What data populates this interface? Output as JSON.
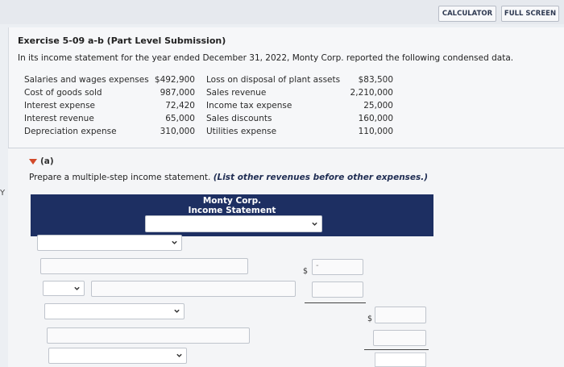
{
  "toolbar": {
    "calculator_label": "CALCULATOR",
    "fullscreen_label": "FULL SCREEN"
  },
  "exercise": {
    "title": "Exercise 5-09 a-b (Part Level Submission)",
    "intro": "In its income statement for the year ended December 31, 2022, Monty Corp. reported the following condensed data."
  },
  "data_table": {
    "left": [
      {
        "label": "Salaries and wages expenses",
        "value": "$492,900"
      },
      {
        "label": "Cost of goods sold",
        "value": "987,000"
      },
      {
        "label": "Interest expense",
        "value": "72,420"
      },
      {
        "label": "Interest revenue",
        "value": "65,000"
      },
      {
        "label": "Depreciation expense",
        "value": "310,000"
      }
    ],
    "right": [
      {
        "label": "Loss on disposal of plant assets",
        "value": "$83,500"
      },
      {
        "label": "Sales revenue",
        "value": "2,210,000"
      },
      {
        "label": "Income tax expense",
        "value": "25,000"
      },
      {
        "label": "Sales discounts",
        "value": "160,000"
      },
      {
        "label": "Utilities expense",
        "value": "110,000"
      }
    ]
  },
  "part_a": {
    "label": "(a)",
    "prompt": "Prepare a multiple-step income statement.",
    "prompt_emphasis": "(List other revenues before other expenses.)"
  },
  "side_char": "Y",
  "statement": {
    "company": "Monty Corp.",
    "title": "Income Statement",
    "period_select": ""
  },
  "form": {
    "dollar_sign": "$",
    "dash": "-"
  },
  "colors": {
    "header_bg": "#1d2f62",
    "marker": "#d24a2a",
    "accent_text": "#1f2d53"
  }
}
